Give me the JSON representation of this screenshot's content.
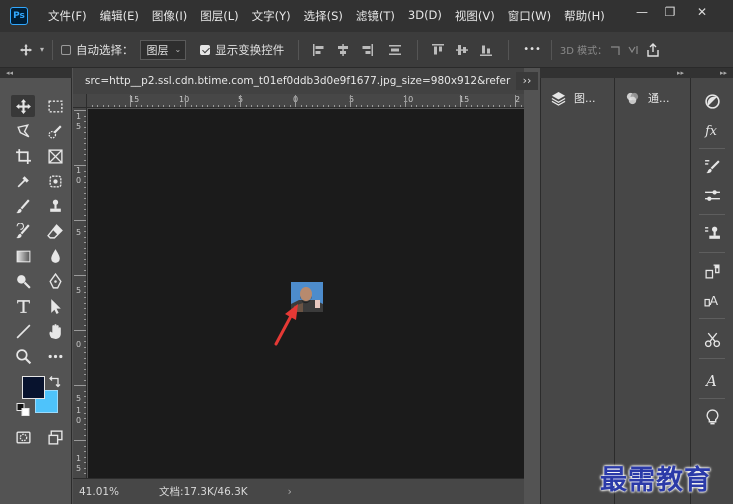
{
  "app": {
    "logo_text": "Ps"
  },
  "menubar": {
    "items": [
      "文件(F)",
      "编辑(E)",
      "图像(I)",
      "图层(L)",
      "文字(Y)",
      "选择(S)",
      "滤镜(T)",
      "3D(D)",
      "视图(V)",
      "窗口(W)",
      "帮助(H)"
    ]
  },
  "window_controls": {
    "minimize": "—",
    "restore": "❐",
    "close": "✕"
  },
  "options_bar": {
    "auto_select_label": "自动选择：",
    "auto_select_checked": false,
    "layer_dropdown_value": "图层",
    "show_transform_label": "显示变换控件",
    "show_transform_checked": true,
    "more_label": "•••",
    "mode_3d_label": "3D 模式："
  },
  "document": {
    "tab_title": "src=http__p2.ssl.cdn.btime.com_t01ef0ddb3d0e9f1677.jpg_size=980x912&refer",
    "zoom": "41.01%",
    "doc_info": "文档:17.3K/46.3K",
    "status_arrow": "›",
    "ruler_h_labels": [
      "15",
      "10",
      "5",
      "0",
      "5",
      "10",
      "15",
      "2"
    ],
    "ruler_v_labels": [
      "1",
      "5",
      "1",
      "0",
      "5",
      "5",
      "0",
      "5",
      "1",
      "0",
      "1",
      "5"
    ]
  },
  "panels": {
    "expand_label": "››",
    "layers_tab": "图...",
    "channels_tab": "通..."
  },
  "colors": {
    "foreground": "#08132e",
    "background": "#4ec3fb",
    "annotation_arrow": "#e53935",
    "accent": "#31a8ff"
  },
  "watermark": {
    "text": "最需教育"
  }
}
